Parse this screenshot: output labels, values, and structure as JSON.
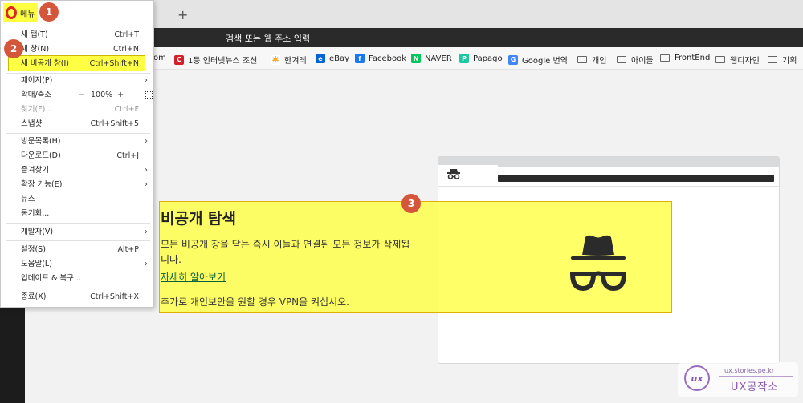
{
  "browser": {
    "new_tab_symbol": "+",
    "address_placeholder": "검색 또는 웹 주소 입력"
  },
  "bookmarks": [
    {
      "label": "om",
      "icon": "google-icon"
    },
    {
      "label": "1등 인터넷뉴스 조선",
      "icon": "chosun-icon",
      "color": "#d4202b"
    },
    {
      "label": "한겨레",
      "icon": "hani-icon",
      "color": "#f5a623"
    },
    {
      "label": "eBay",
      "icon": "ebay-icon",
      "color": "#0064d2"
    },
    {
      "label": "Facebook",
      "icon": "facebook-icon",
      "color": "#1877f2"
    },
    {
      "label": "NAVER",
      "icon": "naver-icon",
      "color": "#03c75a"
    },
    {
      "label": "Papago",
      "icon": "papago-icon",
      "color": "#1ec8a0"
    },
    {
      "label": "Google 번역",
      "icon": "google-translate-icon",
      "color": "#4285f4"
    },
    {
      "label": "개인",
      "icon": "folder-icon"
    },
    {
      "label": "아이들",
      "icon": "folder-icon"
    },
    {
      "label": "FrontEnd",
      "icon": "folder-icon"
    },
    {
      "label": "웹디자인",
      "icon": "folder-icon"
    },
    {
      "label": "기획",
      "icon": "folder-icon"
    }
  ],
  "menu": {
    "title": "메뉴",
    "items": [
      {
        "label": "새 탭(T)",
        "shortcut": "Ctrl+T"
      },
      {
        "label": "새 창(N)",
        "shortcut": "Ctrl+N"
      },
      {
        "label": "새 비공개 창(I)",
        "shortcut": "Ctrl+Shift+N"
      },
      {
        "label": "페이지(P)",
        "submenu": "›"
      },
      {
        "label": "확대/축소",
        "zoom_minus": "−",
        "zoom_value": "100%",
        "zoom_plus": "+"
      },
      {
        "label": "찾기(F)...",
        "shortcut": "Ctrl+F",
        "disabled": true
      },
      {
        "label": "스냅샷",
        "shortcut": "Ctrl+Shift+5"
      },
      {
        "label": "방문목록(H)",
        "submenu": "›"
      },
      {
        "label": "다운로드(D)",
        "shortcut": "Ctrl+J"
      },
      {
        "label": "즐겨찾기",
        "submenu": "›"
      },
      {
        "label": "확장 기능(E)",
        "submenu": "›"
      },
      {
        "label": "뉴스"
      },
      {
        "label": "동기화..."
      },
      {
        "label": "개발자(V)",
        "submenu": "›"
      },
      {
        "label": "설정(S)",
        "shortcut": "Alt+P"
      },
      {
        "label": "도움말(L)",
        "submenu": "›"
      },
      {
        "label": "업데이트 & 복구..."
      },
      {
        "label": "종료(X)",
        "shortcut": "Ctrl+Shift+X"
      }
    ]
  },
  "private": {
    "title": "비공개 탐색",
    "description": "모든 비공개 창을 닫는 즉시 이들과 연결된 모든 정보가 삭제됩니다.",
    "learn_more": "자세히 알아보기",
    "vpn_note": "추가로 개인보안을 원할 경우 VPN을 켜십시오."
  },
  "annotations": {
    "step1": "1",
    "step2": "2",
    "step3": "3",
    "color": "#d5573b",
    "highlight": "#ffff44"
  },
  "watermark": {
    "url": "ux.stories.pe.kr",
    "name": "UX공작소",
    "logo_text": "ux"
  }
}
